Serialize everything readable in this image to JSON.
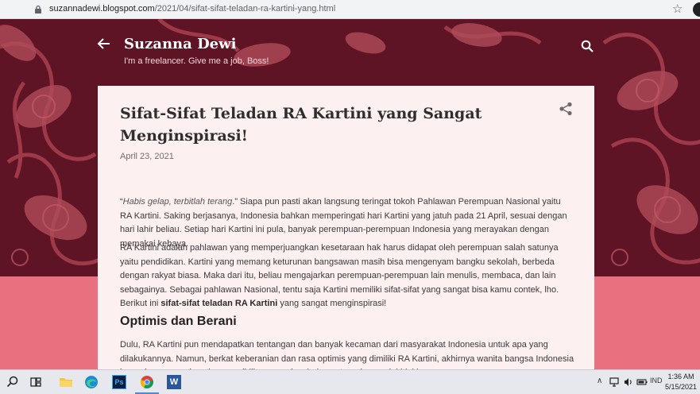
{
  "browser": {
    "url_domain": "suzannadewi.blogspot.com",
    "url_path": "/2021/04/sifat-sifat-teladan-ra-kartini-yang.html"
  },
  "blog": {
    "title": "Suzanna Dewi",
    "description": "I'm a freelancer. Give me a job, Boss!"
  },
  "post": {
    "title": "Sifat-Sifat Teladan RA Kartini yang Sangat Menginspirasi!",
    "date": "April 23, 2021",
    "p1_quote_open": "“",
    "p1_quote": "Habis gelap, terbitlah terang",
    "p1_rest": ".” Siapa pun pasti akan langsung teringat tokoh Pahlawan Perempuan Nasional yaitu RA Kartini. Saking berjasanya, Indonesia bahkan memperingati hari Kartini yang jatuh pada 21 April, sesuai dengan hari lahir beliau. Setiap hari Kartini ini pula, banyak perempuan-perempuan Indonesia yang merayakan dengan memakai kebaya.",
    "p2_text": "RA Kartini adalah pahlawan yang memperjuangkan kesetaraan hak harus didapat oleh perempuan salah satunya yaitu pendidikan. Kartini yang memang keturunan bangsawan masih bisa mengenyam bangku sekolah, berbeda dengan rakyat biasa. Maka dari itu, beliau mengajarkan perempuan-perempuan lain menulis, membaca, dan lain sebagainya. Sebagai pahlawan Nasional, tentu saja Kartini memiliki sifat-sifat yang sangat bisa kamu contek, lho. Berikut ini ",
    "p2_bold": "sifat-sifat teladan RA Kartini",
    "p2_end": " yang sangat menginspirasi!",
    "heading": "Optimis dan Berani",
    "p3_text": "Dulu, RA Kartini pun mendapatkan tentangan dan banyak kecaman dari masyarakat Indonesia untuk apa yang dilakukannya. Namun, berkat keberanian dan rasa optimis yang dimiliki RA Kartini, akhirnya wanita bangsa Indonesia bonar bonar mendapatkan pendidikan yang layak dan setara dengan laki-laki."
  },
  "taskbar": {
    "icons": [
      "search-icon",
      "task-view-icon",
      "file-explorer-icon",
      "edge-icon",
      "photoshop-icon",
      "chrome-icon",
      "word-icon"
    ],
    "photoshop_label": "Ps",
    "word_label": "W",
    "language": "IND",
    "time": "1:36 AM",
    "date": "5/15/2021"
  },
  "colors": {
    "header_bg": "#5e1424",
    "pattern": "#a8404f",
    "pink_band": "#e8707f",
    "card_bg": "#fdf0f0",
    "taskbar_bg": "#e6e8ee"
  }
}
